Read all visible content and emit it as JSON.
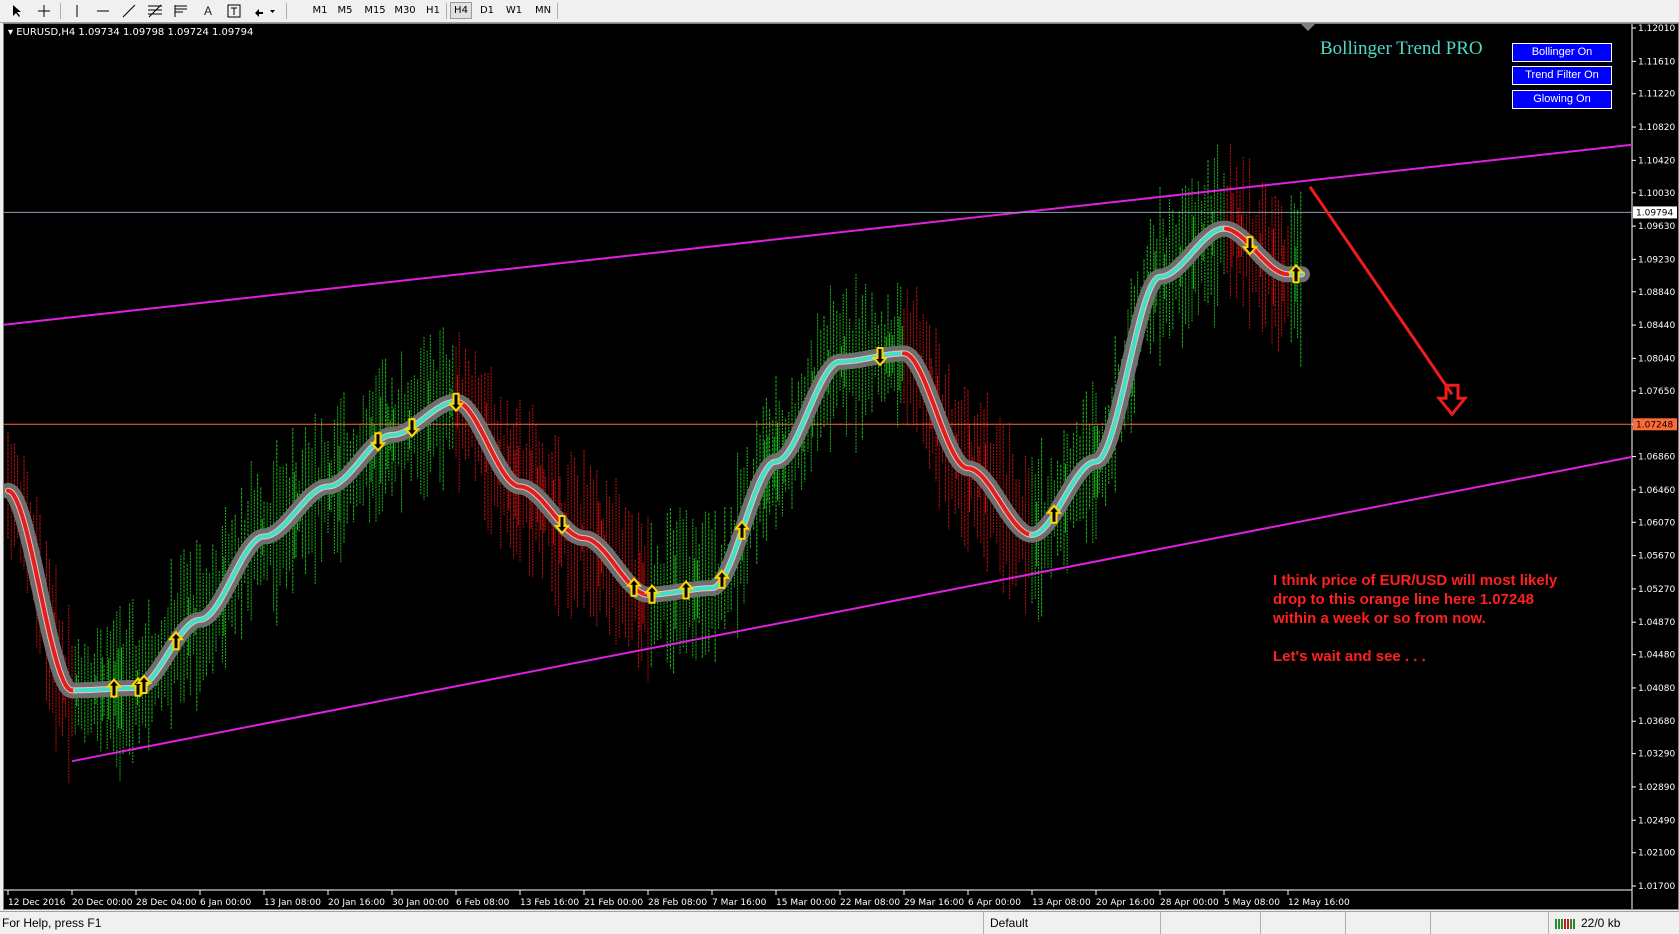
{
  "toolbar": {
    "tools": [
      "cursor-icon",
      "crosshair-icon",
      "vertical-line-icon",
      "horizontal-line-icon",
      "trendline-icon",
      "fibonacci-icon",
      "fibo-fan-icon",
      "text-icon",
      "text-label-icon",
      "arrows-icon"
    ],
    "text_tool": "A",
    "timeframes": [
      {
        "label": "M1",
        "active": false
      },
      {
        "label": "M5",
        "active": false
      },
      {
        "label": "M15",
        "active": false
      },
      {
        "label": "M30",
        "active": false
      },
      {
        "label": "H1",
        "active": false
      },
      {
        "label": "H4",
        "active": true
      },
      {
        "label": "D1",
        "active": false
      },
      {
        "label": "W1",
        "active": false
      },
      {
        "label": "MN",
        "active": false
      }
    ]
  },
  "chart": {
    "header": "EURUSD,H4  1.09734 1.09798 1.09724 1.09794",
    "indicator_title": "Bollinger Trend PRO",
    "buttons": [
      "Bollinger On",
      "Trend Filter On",
      "Glowing On"
    ],
    "current_price_label": "1.09794",
    "orange_line_label": "1.07248",
    "note_lines": [
      "I think price of EUR/USD will most likely",
      "drop to this orange line here 1.07248",
      "within a week or so from now.",
      "",
      "Let's wait and see . . ."
    ],
    "colors": {
      "background": "#000000",
      "up_candles": "#18b818",
      "down_candles": "#c01010",
      "trend_up": "#40e0c8",
      "trend_down": "#e02020",
      "channel": "#e020e0",
      "orange_line": "#ff6a3a",
      "price_line": "#8aa0b8",
      "arrow": "#ee1c1c",
      "signal_arrow": "#ffd700"
    }
  },
  "chart_data": {
    "type": "candlestick",
    "symbol": "EURUSD",
    "timeframe": "H4",
    "y_ticks": [
      "1.12010",
      "1.11610",
      "1.11220",
      "1.10820",
      "1.10420",
      "1.10030",
      "1.09630",
      "1.09230",
      "1.08840",
      "1.08440",
      "1.08040",
      "1.07650",
      "1.07250",
      "1.06860",
      "1.06460",
      "1.06070",
      "1.05670",
      "1.05270",
      "1.04870",
      "1.04480",
      "1.04080",
      "1.03680",
      "1.03290",
      "1.02890",
      "1.02490",
      "1.02100",
      "1.01700"
    ],
    "ylim": [
      1.017,
      1.1201
    ],
    "x_ticks": [
      "12 Dec 2016",
      "20 Dec 00:00",
      "28 Dec 04:00",
      "6 Jan 00:00",
      "13 Jan 08:00",
      "20 Jan 16:00",
      "30 Jan 00:00",
      "6 Feb 08:00",
      "13 Feb 16:00",
      "21 Feb 00:00",
      "28 Feb 08:00",
      "7 Mar 16:00",
      "15 Mar 00:00",
      "22 Mar 08:00",
      "29 Mar 16:00",
      "6 Apr 00:00",
      "13 Apr 08:00",
      "20 Apr 16:00",
      "28 Apr 00:00",
      "5 May 08:00",
      "12 May 16:00"
    ],
    "current_price": 1.09794,
    "horizontal_level": 1.07248,
    "trend_curve": {
      "note": "approximate Bollinger Trend mid-line path, [date label, price]",
      "points": [
        [
          "12 Dec 2016",
          1.0645
        ],
        [
          "20 Dec 00:00",
          1.0405
        ],
        [
          "28 Dec 04:00",
          1.0408
        ],
        [
          "6 Jan 00:00",
          1.049
        ],
        [
          "13 Jan 08:00",
          1.059
        ],
        [
          "20 Jan 16:00",
          1.065
        ],
        [
          "30 Jan 00:00",
          1.0712
        ],
        [
          "6 Feb 08:00",
          1.0752
        ],
        [
          "13 Feb 16:00",
          1.065
        ],
        [
          "21 Feb 00:00",
          1.0588
        ],
        [
          "28 Feb 08:00",
          1.052
        ],
        [
          "7 Mar 16:00",
          1.0528
        ],
        [
          "15 Mar 00:00",
          1.068
        ],
        [
          "22 Mar 08:00",
          1.08
        ],
        [
          "29 Mar 16:00",
          1.081
        ],
        [
          "6 Apr 00:00",
          1.0672
        ],
        [
          "13 Apr 08:00",
          1.0592
        ],
        [
          "20 Apr 16:00",
          1.068
        ],
        [
          "28 Apr 00:00",
          1.0902
        ],
        [
          "5 May 08:00",
          1.096
        ],
        [
          "12 May 16:00",
          1.0905
        ]
      ]
    },
    "channel_upper": [
      [
        "12 Dec 2016",
        1.0845
      ],
      [
        "12 May 16:00",
        1.1015
      ]
    ],
    "channel_lower": [
      [
        "20 Dec 00:00",
        1.032
      ],
      [
        "12 May 16:00",
        1.0605
      ]
    ]
  }
}
